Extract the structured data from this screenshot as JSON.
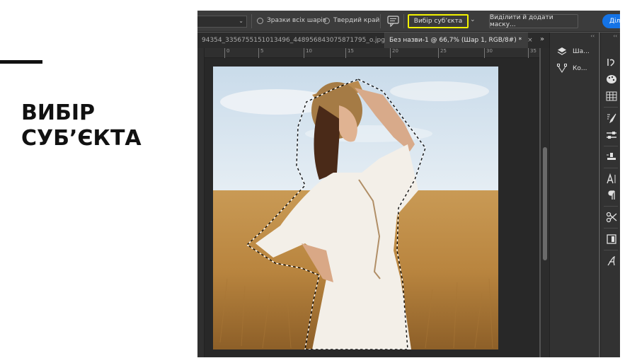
{
  "slide": {
    "title_line1": "ВИБІР",
    "title_line2": "СУБ’ЄКТА"
  },
  "options_bar": {
    "sample_all_layers": "Зразки всіх шарів",
    "hard_edge": "Твердий край",
    "select_subject_button": "Вибір суб’єкта",
    "select_and_mask_button": "Виділити й додати маску...",
    "share_button": "Діли",
    "highlight_color": "#f2f200",
    "share_color": "#1473e6"
  },
  "tabs": [
    {
      "label": "94354_3356755151013496_448956843075871795_o.jpg"
    },
    {
      "label": "Без назви-1 @ 66,7% (Шар 1, RGB/8#) *",
      "close": "×"
    }
  ],
  "tab_overflow_icon": "double-chevron-right-icon",
  "ruler_ticks": [
    "0",
    "5",
    "10",
    "15",
    "20",
    "25",
    "30",
    "35"
  ],
  "right_panel": {
    "items": [
      {
        "label": "Ша...",
        "icon": "layers-icon"
      },
      {
        "label": "Ко...",
        "icon": "paths-icon"
      }
    ],
    "collapse": "‹‹"
  },
  "toolstrip": {
    "icons": [
      "history-icon",
      "color-palette-icon",
      "swatches-grid-icon",
      "brush-settings-icon",
      "tool-presets-icon",
      "clone-source-icon",
      "character-icon",
      "paragraph-icon",
      "adjustments-icon",
      "properties-icon",
      "glyphs-icon"
    ],
    "collapse": "‹‹"
  }
}
